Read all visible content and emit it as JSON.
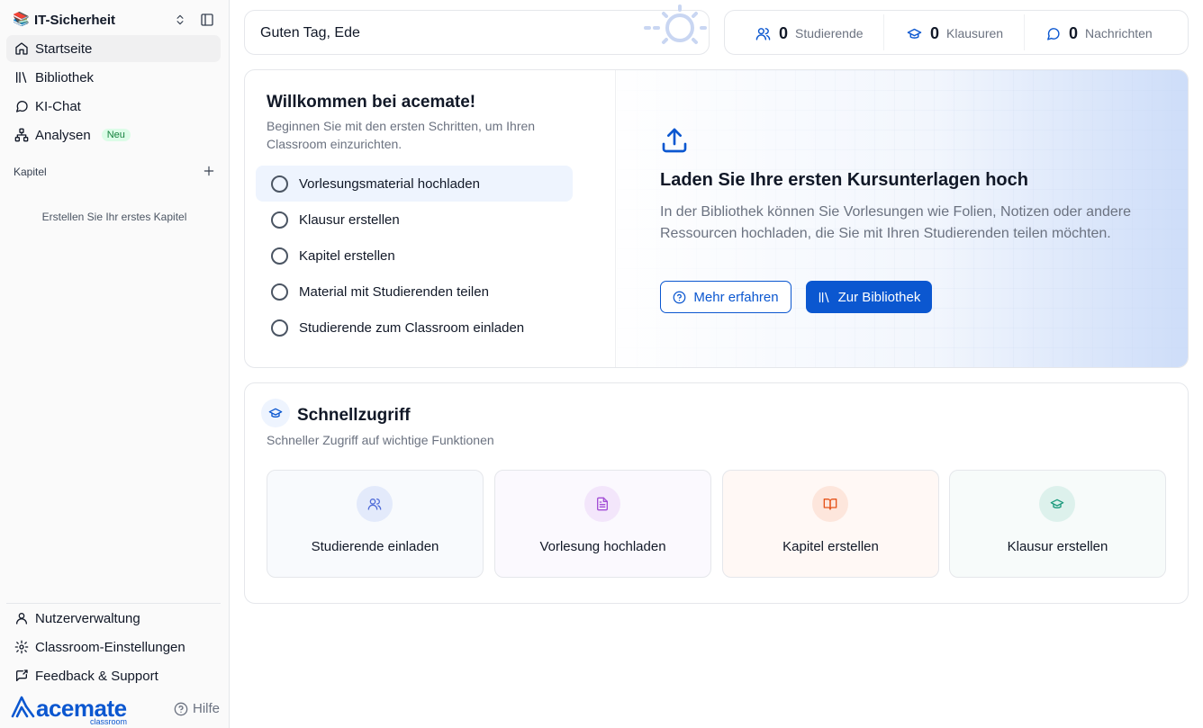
{
  "sidebar": {
    "workspace_title": "IT-Sicherheit",
    "nav": [
      {
        "label": "Startseite",
        "icon": "home-icon",
        "active": true
      },
      {
        "label": "Bibliothek",
        "icon": "library-icon"
      },
      {
        "label": "KI-Chat",
        "icon": "chat-icon"
      },
      {
        "label": "Analysen",
        "icon": "analytics-icon",
        "badge": "Neu"
      }
    ],
    "chapters_heading": "Kapitel",
    "chapters_empty": "Erstellen Sie Ihr erstes Kapitel",
    "bottom_nav": [
      {
        "label": "Nutzerverwaltung",
        "icon": "user-icon"
      },
      {
        "label": "Classroom-Einstellungen",
        "icon": "gear-icon"
      },
      {
        "label": "Feedback & Support",
        "icon": "feedback-icon"
      }
    ],
    "brand_name": "acemate",
    "brand_sub": "classroom",
    "help_label": "Hilfe"
  },
  "header": {
    "greeting": "Guten Tag, Ede",
    "stats": [
      {
        "value": "0",
        "label": "Studierende",
        "icon": "users-icon"
      },
      {
        "value": "0",
        "label": "Klausuren",
        "icon": "graduation-cap-icon"
      },
      {
        "value": "0",
        "label": "Nachrichten",
        "icon": "message-icon"
      }
    ]
  },
  "welcome": {
    "title": "Willkommen bei acemate!",
    "subtitle": "Beginnen Sie mit den ersten Schritten, um Ihren Classroom einzurichten.",
    "steps": [
      "Vorlesungsmaterial hochladen",
      "Klausur erstellen",
      "Kapitel erstellen",
      "Material mit Studierenden teilen",
      "Studierende zum Classroom einladen"
    ],
    "detail_title": "Laden Sie Ihre ersten Kursunterlagen hoch",
    "detail_desc": "In der Bibliothek können Sie Vorlesungen wie Folien, Notizen oder andere Ressourcen hochladen, die Sie mit Ihren Studierenden teilen möchten.",
    "learn_more_label": "Mehr erfahren",
    "library_button_label": "Zur Bibliothek"
  },
  "quick_access": {
    "title": "Schnellzugriff",
    "subtitle": "Schneller Zugriff auf wichtige Funktionen",
    "tiles": [
      {
        "label": "Studierende einladen",
        "icon": "users-icon",
        "color": "#4f6bd8"
      },
      {
        "label": "Vorlesung hochladen",
        "icon": "document-icon",
        "color": "#a44fd6"
      },
      {
        "label": "Kapitel erstellen",
        "icon": "book-open-icon",
        "color": "#e5531a"
      },
      {
        "label": "Klausur erstellen",
        "icon": "graduation-cap-icon",
        "color": "#1c9a7d"
      }
    ]
  },
  "colors": {
    "accent": "#0b57d0",
    "badge_bg": "#dcfce7",
    "badge_text": "#15803d"
  }
}
